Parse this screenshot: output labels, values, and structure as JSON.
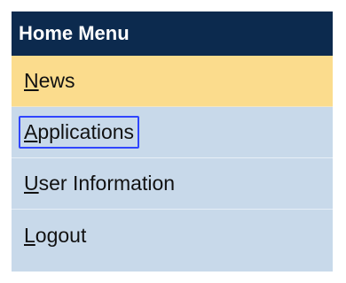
{
  "menu": {
    "title": "Home Menu",
    "items": [
      {
        "accel": "N",
        "rest": "ews",
        "state": "selected"
      },
      {
        "accel": "A",
        "rest": "pplications",
        "state": "focused"
      },
      {
        "accel": "U",
        "rest": "ser Information",
        "state": "normal"
      },
      {
        "accel": "L",
        "rest": "ogout",
        "state": "normal"
      }
    ]
  },
  "colors": {
    "header_bg": "#0c2a4e",
    "item_bg": "#c8d9ea",
    "selected_bg": "#fbdc8d",
    "focus_outline": "#2f45ff"
  }
}
